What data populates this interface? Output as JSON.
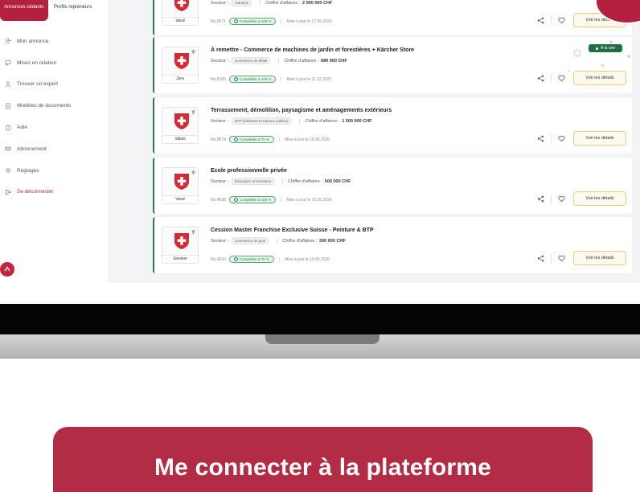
{
  "sidebar": {
    "tabs": [
      {
        "label": "Annonces cédants",
        "active": true
      },
      {
        "label": "Profils repreneurs",
        "active": false
      }
    ],
    "nav": [
      {
        "label": "Mon annonce",
        "icon": "user-plus-icon"
      },
      {
        "label": "Mises en relation",
        "icon": "chat-icon"
      },
      {
        "label": "Trouver un expert",
        "icon": "person-icon"
      },
      {
        "label": "Modèles de documents",
        "icon": "document-icon"
      },
      {
        "label": "Aide",
        "icon": "help-icon"
      },
      {
        "label": "Abonnement",
        "icon": "card-icon"
      },
      {
        "label": "Réglages",
        "icon": "gear-icon"
      },
      {
        "label": "Se déconnecter",
        "icon": "logout-icon"
      }
    ]
  },
  "listings": [
    {
      "canton": "Vaud",
      "title": "",
      "sector_label": "Secteur :",
      "sector": "Industrie",
      "revenue_label": "Chiffre d'affaires :",
      "revenue": "2 000 000 CHF",
      "ref": "No.8071",
      "completion": "Complétée à 100 %",
      "updated": "Mise à jour le 17.05.2026",
      "button": "Voir les détails",
      "badge": ""
    },
    {
      "canton": "Jura",
      "title": "À remettre - Commerce de machines de jardin et forestières + Kärcher Store",
      "sector_label": "Secteur :",
      "sector": "Commerce de détail",
      "revenue_label": "Chiffre d'affaires :",
      "revenue": "680 000 CHF",
      "ref": "No.8106",
      "completion": "Complétée à 100 %",
      "updated": "Mise à jour le 11.12.2025",
      "button": "Voir les détails",
      "badge": "À la une"
    },
    {
      "canton": "Valais",
      "title": "Terrassement, démolition, paysagisme et aménagements extérieurs",
      "sector_label": "Secteur :",
      "sector": "BTP (bâtiment et travaux publics)",
      "revenue_label": "Chiffre d'affaires :",
      "revenue": "1 500 000 CHF",
      "ref": "No.8874",
      "completion": "Complétée à 75 %",
      "updated": "Mise à jour le 16.05.2026",
      "button": "Voir les détails",
      "badge": ""
    },
    {
      "canton": "Vaud",
      "title": "Ecole professionnelle privée",
      "sector_label": "Secteur :",
      "sector": "Éducation et formation",
      "revenue_label": "Chiffre d'affaires :",
      "revenue": "500 000 CHF",
      "ref": "No.4938",
      "completion": "Complétée à 100 %",
      "updated": "Mise à jour le 16.05.2026",
      "button": "Voir les détails",
      "badge": ""
    },
    {
      "canton": "Genève",
      "title": "Cession Master Franchise Exclusive Suisse - Peinture & BTP",
      "sector_label": "Secteur :",
      "sector": "Commerce de gros",
      "revenue_label": "Chiffre d'affaires :",
      "revenue": "300 000 CHF",
      "ref": "No.4332",
      "completion": "Complétée à 75 %",
      "updated": "Mise à jour le 15.05.2026",
      "button": "Voir les détails",
      "badge": ""
    }
  ],
  "cta": {
    "label": "Me connecter à la plateforme"
  },
  "colors": {
    "brand": "#b32040",
    "cta": "#b12c44",
    "accent_green": "#2b7a4b",
    "button_border": "#f0c97a"
  }
}
